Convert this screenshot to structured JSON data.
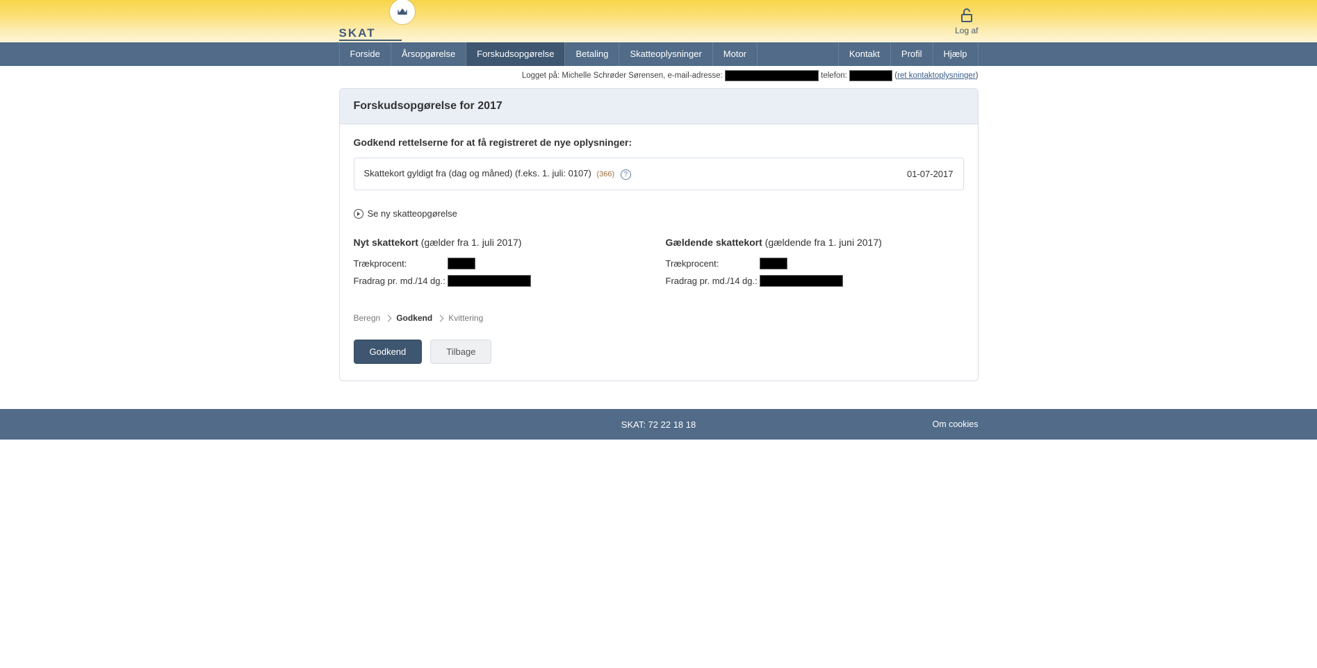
{
  "brand": {
    "name": "SKAT"
  },
  "logoff": {
    "label": "Log af"
  },
  "nav": {
    "left": [
      "Forside",
      "Årsopgørelse",
      "Forskudsopgørelse",
      "Betaling",
      "Skatteoplysninger",
      "Motor"
    ],
    "right": [
      "Kontakt",
      "Profil",
      "Hjælp"
    ],
    "active_index": 2
  },
  "login_strip": {
    "prefix": "Logget på: ",
    "user": "Michelle Schrøder Sørensen",
    "email_label": ", e-mail-adresse: ",
    "phone_label": " telefon: ",
    "link": "ret kontaktoplysninger"
  },
  "page": {
    "title": "Forskudsopgørelse for 2017",
    "approve_heading": "Godkend rettelserne for at få registreret de nye oplysninger:",
    "info": {
      "label": "Skattekort gyldigt fra (dag og måned) (f.eks. 1. juli: 0107)",
      "code": "(366)",
      "value": "01-07-2017"
    },
    "expand": "Se ny skatteopgørelse",
    "new_card": {
      "title_strong": "Nyt skattekort",
      "title_light": " (gælder fra 1. juli 2017)",
      "percent_label": "Trækprocent:",
      "deduct_label": "Fradrag pr. md./14 dg.:"
    },
    "current_card": {
      "title_strong": "Gældende skattekort",
      "title_light": " (gældende fra 1. juni 2017)",
      "percent_label": "Trækprocent:",
      "deduct_label": "Fradrag pr. md./14 dg.:"
    },
    "steps": [
      "Beregn",
      "Godkend",
      "Kvittering"
    ],
    "active_step": 1,
    "buttons": {
      "approve": "Godkend",
      "back": "Tilbage"
    }
  },
  "footer": {
    "center": "SKAT: 72 22 18 18",
    "cookies": "Om cookies"
  }
}
